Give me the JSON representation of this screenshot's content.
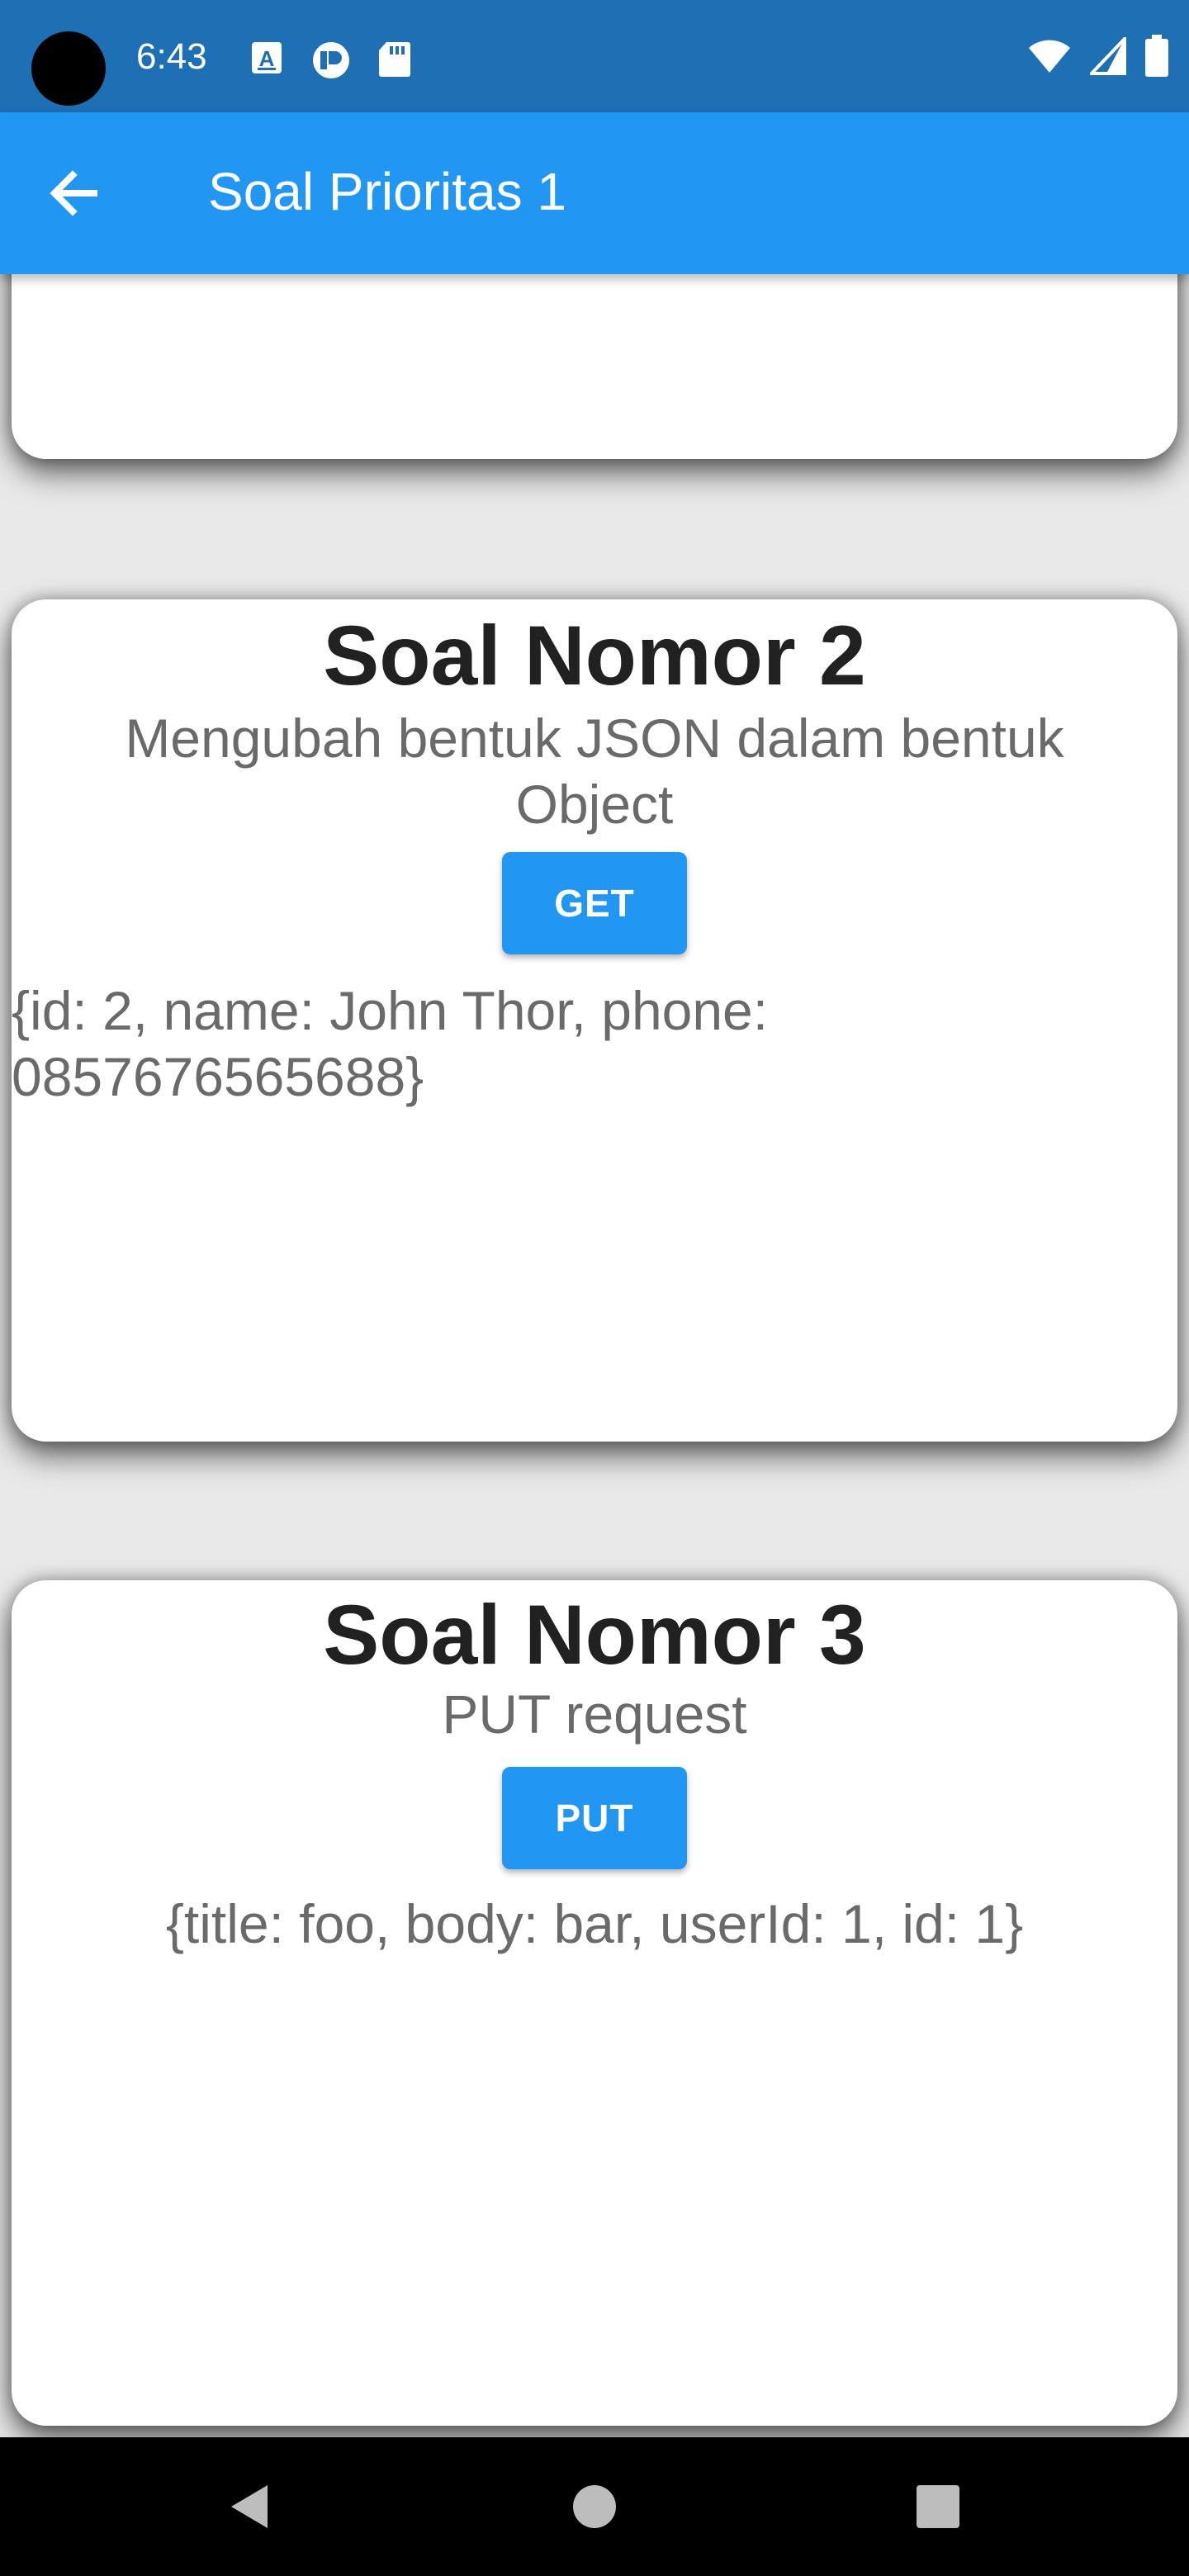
{
  "status_bar": {
    "time": "6:43",
    "left_icons": [
      "a-box-icon",
      "clipboard-p-icon",
      "sd-card-icon"
    ],
    "right_icons": [
      "wifi-icon",
      "signal-icon",
      "battery-icon"
    ],
    "background": "#1f6fb5"
  },
  "app_bar": {
    "title": "Soal Prioritas 1",
    "background": "#2196f3"
  },
  "cards": [
    {
      "title": "Soal Nomor 2",
      "subtitle": "Mengubah bentuk JSON dalam bentuk Object",
      "button_label": "GET",
      "result": "{id: 2, name: John Thor, phone: 0857676565688}"
    },
    {
      "title": "Soal Nomor 3",
      "subtitle": "PUT request",
      "button_label": "PUT",
      "result": "{title: foo, body: bar, userId: 1, id: 1}"
    }
  ],
  "nav_bar": {
    "buttons": [
      "back-triangle-icon",
      "home-circle-icon",
      "recents-square-icon"
    ]
  }
}
